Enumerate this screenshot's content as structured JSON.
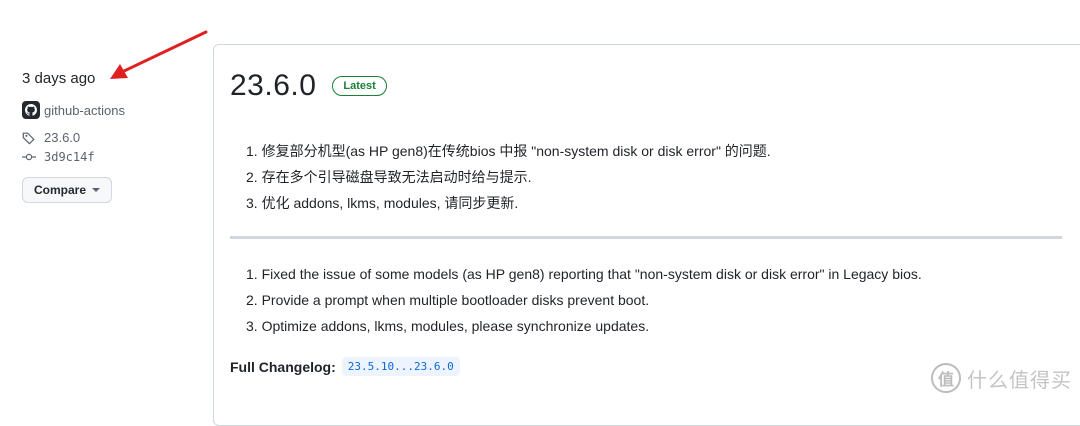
{
  "sidebar": {
    "date": "3 days ago",
    "author": "github-actions",
    "tag": "23.6.0",
    "commit": "3d9c14f",
    "compare_label": "Compare"
  },
  "release": {
    "title": "23.6.0",
    "badge": "Latest",
    "notes_cn": [
      "1. 修复部分机型(as HP gen8)在传统bios 中报 \"non-system disk or disk error\" 的问题.",
      "2. 存在多个引导磁盘导致无法启动时给与提示.",
      "3. 优化 addons, lkms, modules, 请同步更新."
    ],
    "notes_en": [
      "1. Fixed the issue of some models (as HP gen8) reporting that \"non-system disk or disk error\" in Legacy bios.",
      "2. Provide a prompt when multiple bootloader disks prevent boot.",
      "3. Optimize addons, lkms, modules, please synchronize updates."
    ],
    "changelog_label": "Full Changelog:",
    "changelog_link": "23.5.10...23.6.0"
  },
  "watermark": {
    "text": "什么值得买",
    "glyph": "值"
  },
  "colors": {
    "badge_green": "#1a7f37",
    "link_blue": "#0969da",
    "arrow_red": "#e02020"
  }
}
